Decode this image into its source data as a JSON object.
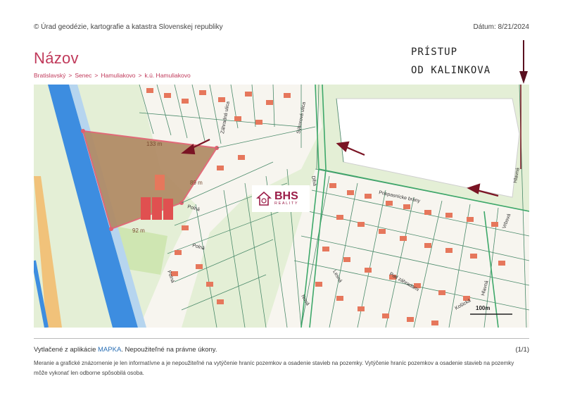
{
  "header": {
    "copyright": "© Úrad geodézie, kartografie a katastra Slovenskej republiky",
    "date": "Dátum: 8/21/2024"
  },
  "title": "Názov",
  "breadcrumb": [
    "Bratislavský",
    "Senec",
    "Hamuliakovo",
    "k.ú. Hamuliakovo"
  ],
  "breadcrumb_separator": ">",
  "handwritten": {
    "line1": "PRÍSTUP",
    "line2": "OD KALINKOVA"
  },
  "map": {
    "parcel_dimensions": [
      "133 m",
      "89 m",
      "92 m"
    ],
    "street_names": [
      "Polná",
      "Polná",
      "Polná",
      "Priepasnícke brány",
      "Pod záhradami",
      "Hlavná",
      "Hlavná",
      "Vrbová",
      "Lesná",
      "Nová",
      "Košická",
      "Dlhá",
      "Sýkorová ulica",
      "Záhradná ulica"
    ],
    "scale_label": "100m",
    "colors": {
      "parcel_fill": "#b08a64",
      "parcel_edge": "#e06070",
      "water": "#3d8de0",
      "road_stroke": "#4a8a6a",
      "building": "#e6775c"
    }
  },
  "logo": {
    "brand": "BHS",
    "sub": "REALITY"
  },
  "footer": {
    "printed_prefix": "Vytlačené z aplikácie ",
    "app_name": "MAPKA",
    "printed_suffix": ". Nepoužiteľné na právne úkony.",
    "page": "(1/1)",
    "disclaimer": "Meranie a grafické znázornenie je len informatívne a je nepoužiteľné na vytýčenie hraníc pozemkov a osadenie stavieb na pozemky. Vytýčenie hraníc pozemkov a osadenie stavieb na pozemky môže vykonať len odborne spôsobilá osoba."
  }
}
